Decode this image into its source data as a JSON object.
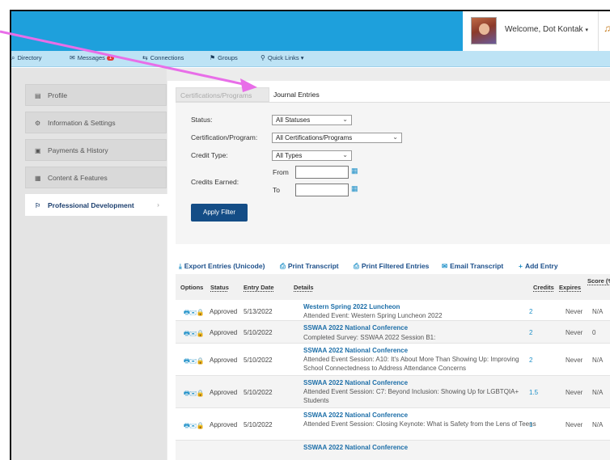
{
  "header": {
    "welcome": "Welcome, Dot Kontak",
    "caret": "▾"
  },
  "nav": {
    "items": [
      {
        "icon": "⌕",
        "label": "Directory"
      },
      {
        "icon": "✉",
        "label": "Messages",
        "badge": "1"
      },
      {
        "icon": "⇆",
        "label": "Connections"
      },
      {
        "icon": "⚑",
        "label": "Groups"
      },
      {
        "icon": "⚲",
        "label": "Quick Links ▾"
      }
    ]
  },
  "sidebar": {
    "items": [
      {
        "icon": "▤",
        "label": "Profile"
      },
      {
        "icon": "⚙",
        "label": "Information & Settings"
      },
      {
        "icon": "▣",
        "label": "Payments & History"
      },
      {
        "icon": "▦",
        "label": "Content & Features"
      },
      {
        "icon": "⚐",
        "label": "Professional Development",
        "chevron": "›"
      }
    ]
  },
  "tabs": {
    "certifications": "Certifications/Programs",
    "journal": "Journal Entries"
  },
  "filter": {
    "status_label": "Status:",
    "status_value": "All Statuses",
    "program_label": "Certification/Program:",
    "program_value": "All Certifications/Programs",
    "credit_type_label": "Credit Type:",
    "credit_type_value": "All Types",
    "credits_earned_label": "Credits Earned:",
    "from_label": "From",
    "to_label": "To",
    "apply_label": "Apply Filter"
  },
  "actions": {
    "export": "Export Entries (Unicode)",
    "print_transcript": "Print Transcript",
    "print_filtered": "Print Filtered Entries",
    "email_transcript": "Email Transcript",
    "add_entry": "Add Entry"
  },
  "table": {
    "headers": {
      "options": "Options",
      "status": "Status",
      "entry_date": "Entry Date",
      "details": "Details",
      "credits": "Credits",
      "expires": "Expires",
      "score": "Score (%)"
    },
    "row_icons": "🖶✉🔒",
    "rows": [
      {
        "status": "Approved",
        "date": "5/13/2022",
        "title": "Western Spring 2022 Luncheon",
        "desc": "Attended Event: Western Spring Luncheon 2022",
        "credits": "2",
        "expires": "Never",
        "score": "N/A"
      },
      {
        "status": "Approved",
        "date": "5/10/2022",
        "title": "SSWAA 2022 National Conference",
        "desc": "Completed Survey: SSWAA 2022 Session B1:",
        "credits": "2",
        "expires": "Never",
        "score": "0"
      },
      {
        "status": "Approved",
        "date": "5/10/2022",
        "title": "SSWAA 2022 National Conference",
        "desc": "Attended Event Session: A10: It's About More Than Showing Up: Improving School Connectedness to Address Attendance Concerns",
        "credits": "2",
        "expires": "Never",
        "score": "N/A"
      },
      {
        "status": "Approved",
        "date": "5/10/2022",
        "title": "SSWAA 2022 National Conference",
        "desc": "Attended Event Session: C7: Beyond Inclusion: Showing Up for LGBTQIA+ Students",
        "credits": "1.5",
        "expires": "Never",
        "score": "N/A"
      },
      {
        "status": "Approved",
        "date": "5/10/2022",
        "title": "SSWAA 2022 National Conference",
        "desc": "Attended Event Session: Closing Keynote: What is Safety from the Lens of Teens",
        "credits": "1",
        "expires": "Never",
        "score": "N/A"
      },
      {
        "status": "",
        "date": "",
        "title": "SSWAA 2022 National Conference",
        "desc": "",
        "credits": "",
        "expires": "",
        "score": ""
      }
    ]
  },
  "colors": {
    "topbar": "#1ea0dc",
    "navbar": "#bde3f5",
    "link": "#1c6ea8",
    "apply_button": "#144d86",
    "annotation_arrow": "#e86ee8"
  }
}
